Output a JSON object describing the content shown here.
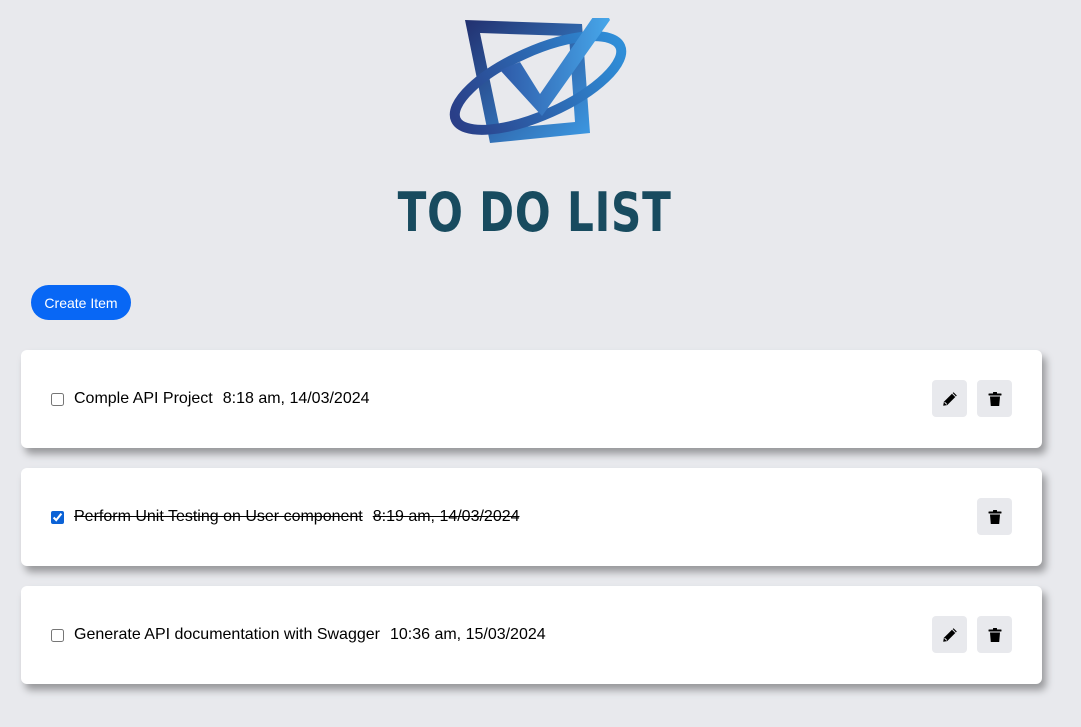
{
  "brand": {
    "title": "TO DO LIST",
    "colors": {
      "dark": "#22306f",
      "light": "#3d9be5",
      "text": "#184b5f"
    }
  },
  "toolbar": {
    "create_label": "Create Item"
  },
  "todos": [
    {
      "text": "Comple API Project",
      "time": "8:18 am, 14/03/2024",
      "completed": false,
      "actions": [
        "pencil-icon",
        "trash-icon"
      ]
    },
    {
      "text": "Perform Unit Testing on User component",
      "time": "8:19 am, 14/03/2024",
      "completed": true,
      "actions": [
        "trash-icon"
      ]
    },
    {
      "text": "Generate API documentation with Swagger",
      "time": "10:36 am, 15/03/2024",
      "completed": false,
      "actions": [
        "pencil-icon",
        "trash-icon"
      ]
    }
  ],
  "colors": {
    "background": "#e8e9ed",
    "primary_button": "#0867f5",
    "card": "#ffffff"
  }
}
